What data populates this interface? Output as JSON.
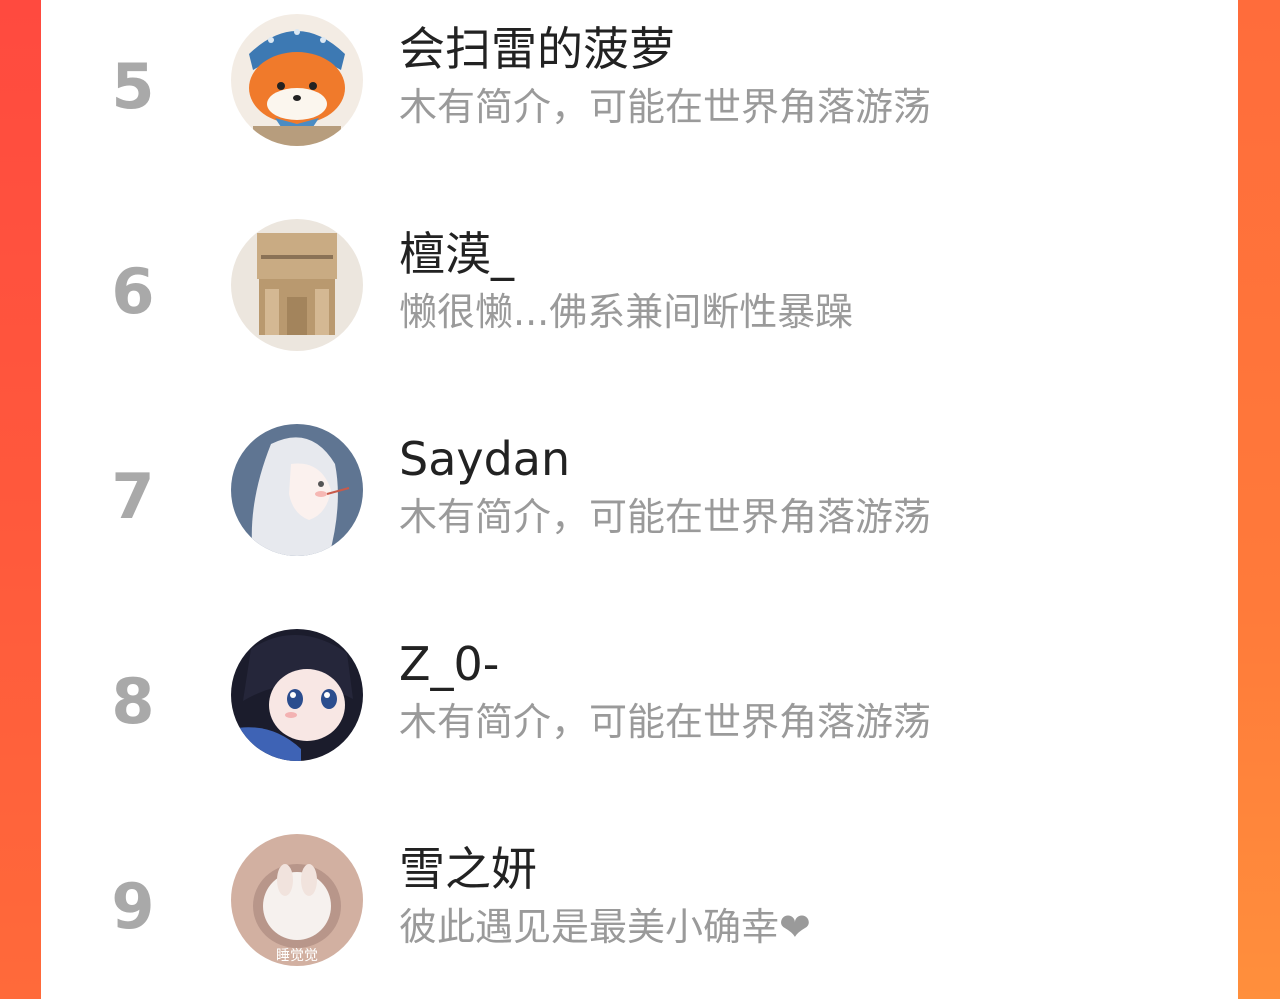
{
  "list": [
    {
      "rank": "5",
      "name": "会扫雷的菠萝",
      "bio": "木有简介，可能在世界角落游荡",
      "avatar": "fox-avatar"
    },
    {
      "rank": "6",
      "name": "檀漠_",
      "bio": "懒很懒...佛系兼间断性暴躁",
      "avatar": "cardboard-avatar"
    },
    {
      "rank": "7",
      "name": "Saydan",
      "bio": "木有简介，可能在世界角落游荡",
      "avatar": "anime-girl-avatar"
    },
    {
      "rank": "8",
      "name": "Z_0-",
      "bio": "木有简介，可能在世界角落游荡",
      "avatar": "anime-face-avatar"
    },
    {
      "rank": "9",
      "name": "雪之妍",
      "bio": "彼此遇见是最美小确幸❤",
      "avatar": "bunny-avatar",
      "avatar_caption": "睡觉觉"
    }
  ],
  "colors": {
    "accent_left": "#ff4a3f",
    "accent_right": "#ff7a3a",
    "rank": "#a9a9a9",
    "name": "#222222",
    "bio": "#9a9a9a"
  }
}
